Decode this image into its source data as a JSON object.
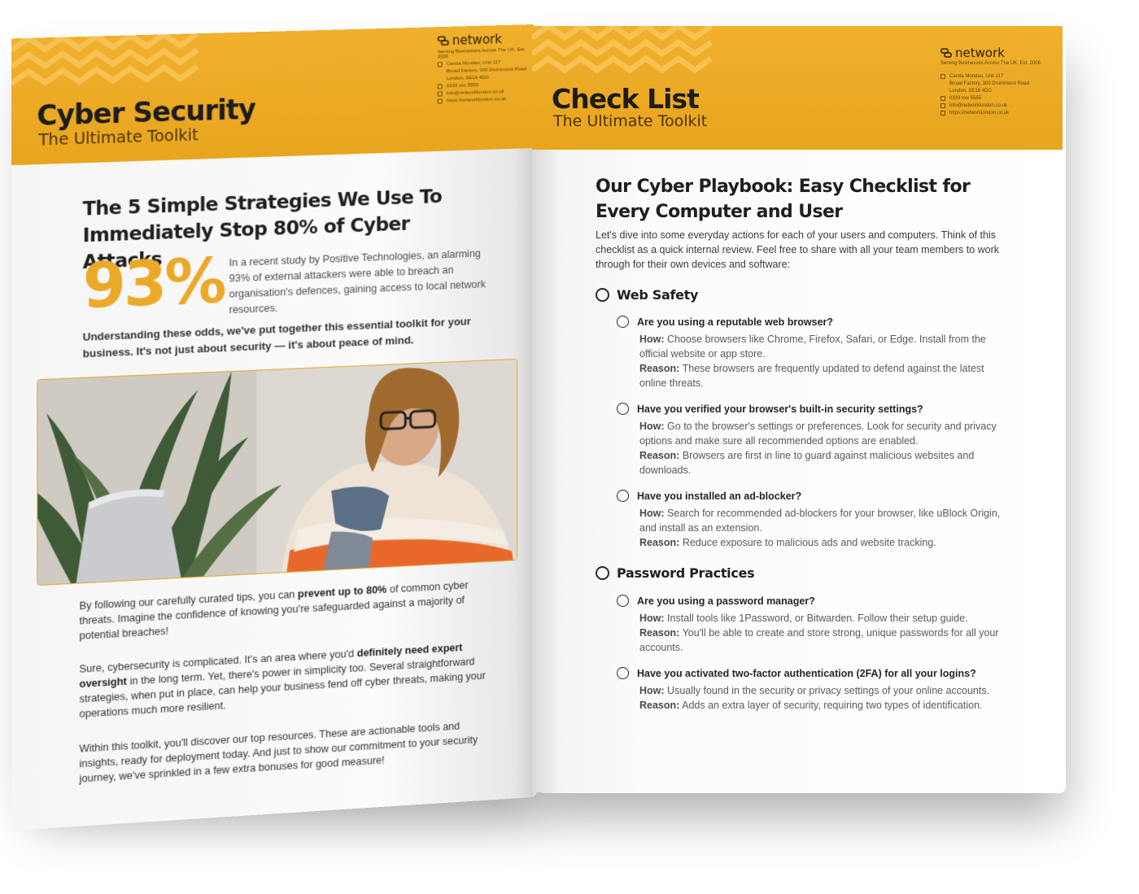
{
  "left_page": {
    "brand": "network",
    "brand_tagline": "Serving Businesses Across The UK, Est. 2006",
    "contact": [
      "Carola Mondao, Unit 117",
      "Broad Factory, 300 Drummond Road",
      "London, SE16 4DG",
      "0333 xxx 5555",
      "info@networklondon.co.uk",
      "https://networklondon.co.uk"
    ],
    "title": "Cyber Security",
    "subtitle": "The Ultimate Toolkit",
    "headline_line1": "The 5 Simple Strategies We Use To",
    "headline_line2": "Immediately Stop 80% of Cyber Attacks",
    "stat_value": "93%",
    "stat_text": "In a recent study by Positive Technologies, an alarming 93% of external attackers were able to breach an organisation's defences, gaining access to local network resources.",
    "lead": "Understanding these odds, we've put together this essential toolkit for your business. It's not just about security — it's about peace of mind.",
    "p1_pre": "By following our carefully curated tips, you can ",
    "p1_bold": "prevent up to 80%",
    "p1_post": " of common cyber threats. Imagine the confidence of knowing you're safeguarded against a majority of potential breaches!",
    "p2_pre": "Sure, cybersecurity is complicated. It's an area where you'd ",
    "p2_bold": "definitely need expert oversight",
    "p2_post": " in the long term. Yet, there's power in simplicity too. Several straightforward strategies, when put in place, can help your business fend off cyber threats, making your operations much more resilient.",
    "p3": "Within this toolkit, you'll discover our top resources. These are actionable tools and insights, ready for deployment today. And just to show our commitment to your security journey, we've sprinkled in a few extra bonuses for good measure!"
  },
  "right_page": {
    "brand": "network",
    "brand_tagline": "Serving Businesses Across The UK, Est. 2006",
    "contact": [
      "Carola Mondao, Unit 117",
      "Broad Factory, 300 Drummond Road",
      "London, SE16 4DG",
      "0333 xxx 5555",
      "info@networklondon.co.uk",
      "https://networklondon.co.uk"
    ],
    "title": "Check List",
    "subtitle": "The Ultimate Toolkit",
    "headline_line1": "Our Cyber Playbook: Easy Checklist for",
    "headline_line2": "Every Computer and User",
    "intro": "Let's dive into some everyday actions for each of your users and computers. Think of this checklist as a quick internal review. Feel free to share with all your team members to work through for their own devices and software:",
    "how_label": "How:",
    "reason_label": "Reason:",
    "sections": [
      {
        "title": "Web Safety",
        "items": [
          {
            "q": "Are you using a reputable web browser?",
            "how": "Choose browsers like Chrome, Firefox, Safari, or Edge. Install from the official website or app store.",
            "reason": "These browsers are frequently updated to defend against the latest online threats."
          },
          {
            "q": "Have you verified your browser's built-in security settings?",
            "how": "Go to the browser's settings or preferences. Look for security and privacy options and make sure all recommended options are enabled.",
            "reason": "Browsers are first in line to guard against malicious websites and downloads."
          },
          {
            "q": "Have you installed an ad-blocker?",
            "how": "Search for recommended ad-blockers for your browser, like uBlock Origin, and install as an extension.",
            "reason": "Reduce exposure to malicious ads and website tracking."
          }
        ]
      },
      {
        "title": "Password Practices",
        "items": [
          {
            "q": "Are you using a password manager?",
            "how": "Install tools like 1Password, or Bitwarden. Follow their setup guide.",
            "reason": "You'll be able to create and store strong, unique passwords for all your accounts."
          },
          {
            "q": "Have you activated two-factor authentication (2FA) for all your logins?",
            "how": "Usually found in the security or privacy settings of your online accounts.",
            "reason": "Adds an extra layer of security, requiring two types of identification."
          }
        ]
      }
    ]
  },
  "colors": {
    "accent": "#eba928",
    "band": "#e8a51e",
    "text": "#2b2b2b"
  }
}
